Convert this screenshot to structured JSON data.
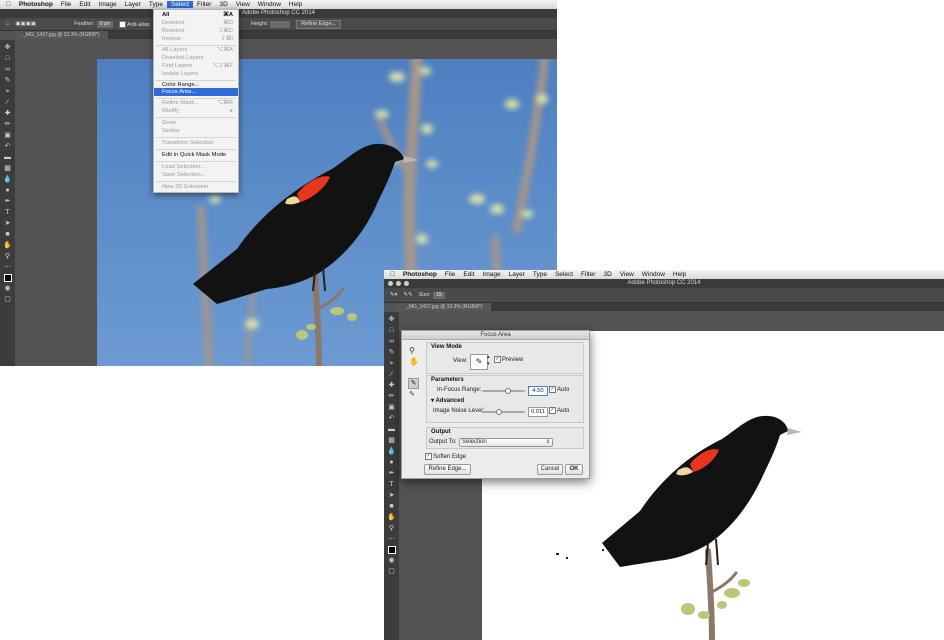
{
  "window1": {
    "menubar": {
      "app": "Photoshop",
      "items": [
        "File",
        "Edit",
        "Image",
        "Layer",
        "Type",
        "Select",
        "Filter",
        "3D",
        "View",
        "Window",
        "Help"
      ],
      "active": "Select"
    },
    "title": "Adobe Photoshop CC 2014",
    "options": {
      "feather_label": "Feather:",
      "feather_value": "0 px",
      "anti_alias": "Anti-alias",
      "style_label": "St",
      "height_label": "Height:",
      "refine_edge": "Refine Edge..."
    },
    "doc_tab": "_MG_1437.jpg @ 33.3% (RGB/8*)"
  },
  "select_menu": {
    "items": [
      {
        "label": "All",
        "shortcut": "⌘A",
        "state": "normal"
      },
      {
        "label": "Deselect",
        "shortcut": "⌘D",
        "state": "disabled"
      },
      {
        "label": "Reselect",
        "shortcut": "⇧⌘D",
        "state": "disabled"
      },
      {
        "label": "Inverse",
        "shortcut": "⇧⌘I",
        "state": "disabled"
      },
      {
        "label": "All Layers",
        "shortcut": "⌥⌘A",
        "state": "disabled"
      },
      {
        "label": "Deselect Layers",
        "shortcut": "",
        "state": "disabled"
      },
      {
        "label": "Find Layers",
        "shortcut": "⌥⇧⌘F",
        "state": "disabled"
      },
      {
        "label": "Isolate Layers",
        "shortcut": "",
        "state": "disabled"
      },
      {
        "label": "Color Range...",
        "shortcut": "",
        "state": "normal"
      },
      {
        "label": "Focus Area...",
        "shortcut": "",
        "state": "selected"
      },
      {
        "label": "Refine Mask...",
        "shortcut": "⌥⌘R",
        "state": "disabled"
      },
      {
        "label": "Modify",
        "shortcut": "▸",
        "state": "disabled"
      },
      {
        "label": "Grow",
        "shortcut": "",
        "state": "disabled"
      },
      {
        "label": "Similar",
        "shortcut": "",
        "state": "disabled"
      },
      {
        "label": "Transform Selection",
        "shortcut": "",
        "state": "disabled"
      },
      {
        "label": "Edit in Quick Mask Mode",
        "shortcut": "",
        "state": "normal"
      },
      {
        "label": "Load Selection...",
        "shortcut": "",
        "state": "disabled"
      },
      {
        "label": "Save Selection...",
        "shortcut": "",
        "state": "disabled"
      },
      {
        "label": "New 3D Extrusion",
        "shortcut": "",
        "state": "disabled"
      }
    ]
  },
  "window2": {
    "menubar": {
      "app": "Photoshop",
      "items": [
        "File",
        "Edit",
        "Image",
        "Layer",
        "Type",
        "Select",
        "Filter",
        "3D",
        "View",
        "Window",
        "Help"
      ]
    },
    "title": "Adobe Photoshop CC 2014",
    "options": {
      "size_label": "Size:",
      "size_value": "15"
    },
    "doc_tab": "_MG_1437.jpg @ 33.3% (RGB/8*)"
  },
  "focus_area_dialog": {
    "title": "Focus Area",
    "view_mode_heading": "View Mode",
    "view_label": "View:",
    "preview_label": "Preview",
    "preview_checked": true,
    "parameters_heading": "Parameters",
    "in_focus_range_label": "In-Focus Range:",
    "in_focus_range_value": "4.50",
    "in_focus_range_level": 0.6,
    "auto_label": "Auto",
    "advanced_label": "Advanced",
    "image_noise_label": "Image Noise Level:",
    "image_noise_value": "0.011",
    "image_noise_level": 0.4,
    "output_heading": "Output",
    "output_to_label": "Output To:",
    "output_to_value": "Selection",
    "soften_edge_label": "Soften Edge",
    "soften_edge_checked": true,
    "refine_edge_button": "Refine Edge...",
    "cancel_button": "Cancel",
    "ok_button": "OK"
  },
  "colors": {
    "accent": "#2f6bd9",
    "ps_bg": "#535353",
    "sky": "#5a8bc8",
    "epaulet_red": "#e8361c",
    "epaulet_yellow": "#f0d7a0"
  }
}
